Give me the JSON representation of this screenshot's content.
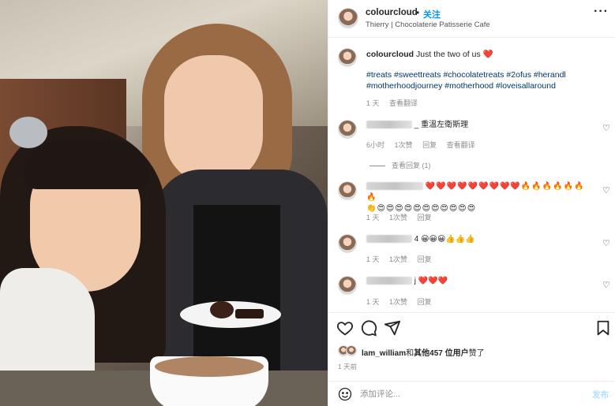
{
  "header": {
    "username": "colourcloud",
    "dot": "•",
    "follow_label": "关注",
    "location": "Thierry | Chocolaterie Patisserie Cafe",
    "more_icon": "more-horizontal-icon"
  },
  "caption": {
    "username": "colourcloud",
    "text": "Just the two of us",
    "heart": "❤️",
    "hashtags": "#treats #sweettreats #chocolatetreats #2ofus #herandl #motherhoodjourney #motherhood #loveisallaround",
    "time": "1 天",
    "translate": "查看翻译"
  },
  "comments": [
    {
      "text": "_ 重溫左衛斯理",
      "time": "6小时",
      "likes": "1次赞",
      "reply": "回复",
      "translate": "查看翻译"
    },
    {
      "text": "❤️❤️❤️❤️❤️❤️❤️❤️❤️🔥🔥🔥🔥🔥🔥🔥",
      "text2": "👏😍😍😍😍😍😍😍😍😍😍😍",
      "time": "1 天",
      "likes": "1次赞",
      "reply": "回复"
    },
    {
      "text": "4 😀😀😀👍👍👍",
      "time": "1 天",
      "likes": "1次赞",
      "reply": "回复"
    },
    {
      "text": "j ❤️❤️❤️",
      "time": "1 天",
      "likes": "1次赞",
      "reply": "回复"
    }
  ],
  "view_replies": "查看回复 (1)",
  "likes": {
    "user": "lam_william",
    "and": "和",
    "others": "其他457 位用户",
    "suffix": "赞了"
  },
  "post_time": "1 天前",
  "add_comment": {
    "placeholder": "添加评论...",
    "post_label": "发布"
  },
  "colors": {
    "link": "#00376b",
    "follow": "#0095f6",
    "post_disabled": "#b2dffc"
  }
}
